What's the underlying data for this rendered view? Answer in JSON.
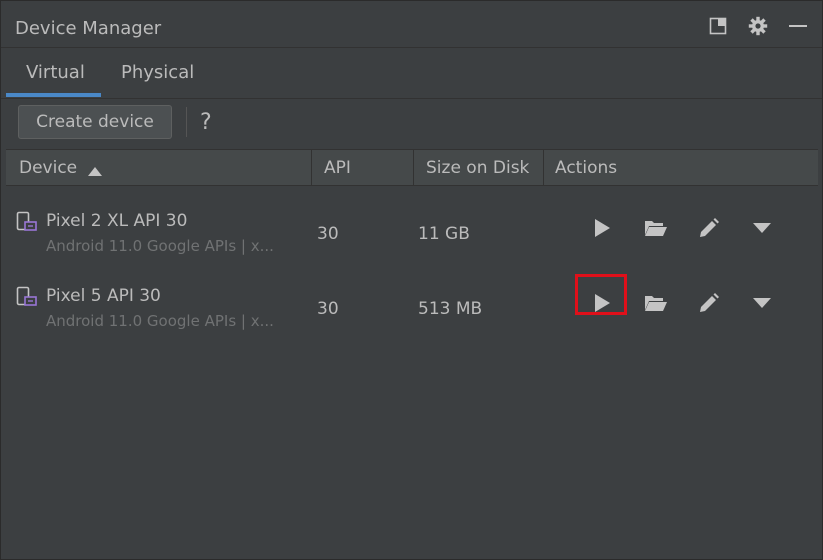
{
  "window": {
    "title": "Device Manager",
    "title_icons": [
      "restore-panel-icon",
      "gear-icon",
      "minimize-icon"
    ]
  },
  "tabs": [
    {
      "label": "Virtual",
      "selected": true
    },
    {
      "label": "Physical",
      "selected": false
    }
  ],
  "toolbar": {
    "create_label": "Create device",
    "help_label": "?"
  },
  "table": {
    "columns": [
      "Device",
      "API",
      "Size on Disk",
      "Actions"
    ],
    "sort_column": "Device",
    "sort_direction": "ascending",
    "rows": [
      {
        "name": "Pixel 2 XL API 30",
        "subtitle": "Android 11.0 Google APIs | x...",
        "api": "30",
        "size": "11 GB",
        "actions": [
          "play-icon",
          "folder-open-icon",
          "pencil-icon",
          "caret-down-icon"
        ],
        "highlighted_action": null
      },
      {
        "name": "Pixel 5 API 30",
        "subtitle": "Android 11.0 Google APIs | x...",
        "api": "30",
        "size": "513 MB",
        "actions": [
          "play-icon",
          "folder-open-icon",
          "pencil-icon",
          "caret-down-icon"
        ],
        "highlighted_action": "play-icon"
      }
    ]
  },
  "colors": {
    "background": "#3c3f41",
    "header_bg": "#45494a",
    "tab_accent": "#4a88c7",
    "highlight": "#e0101a",
    "device_icon_accent": "#9876d5"
  }
}
